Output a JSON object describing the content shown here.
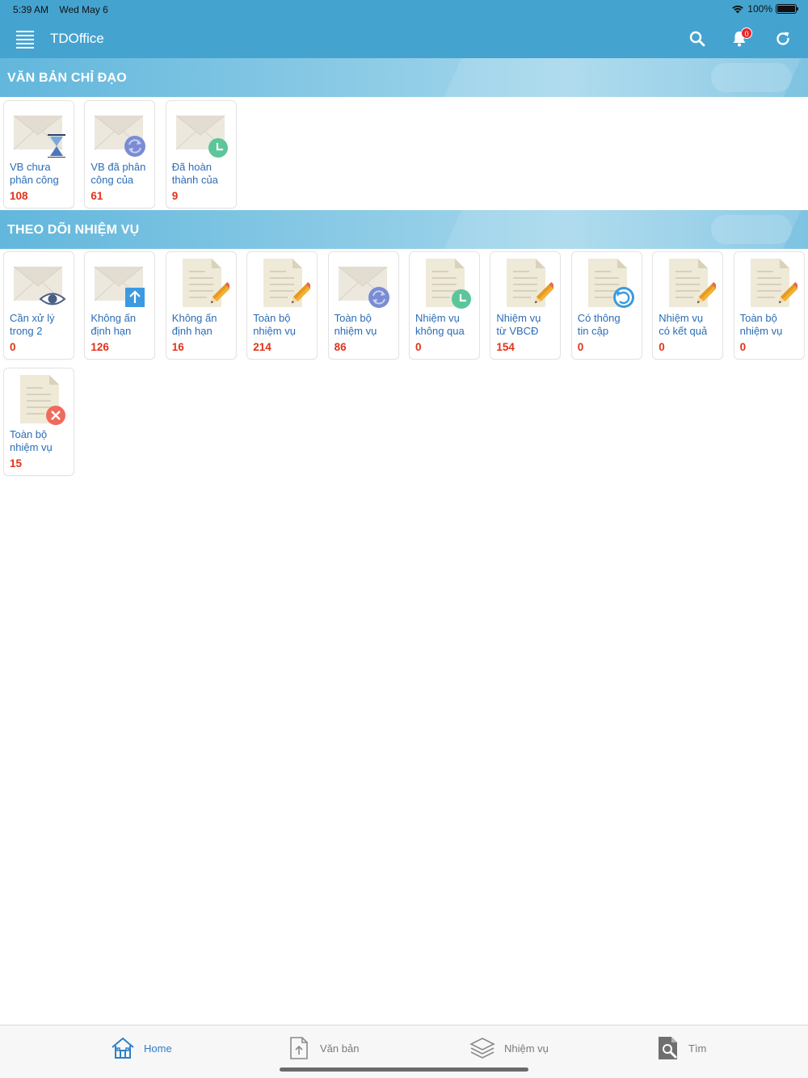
{
  "status": {
    "time": "5:39 AM",
    "date": "Wed May 6",
    "battery": "100%"
  },
  "header": {
    "title": "TDOffice",
    "notification_count": "0"
  },
  "sections": [
    {
      "title": "VĂN BẢN CHỈ ĐẠO",
      "tiles": [
        {
          "label": "VB chưa\nphân công",
          "count": "108",
          "icon": "envelope-hourglass-icon"
        },
        {
          "label": "VB đã phân\ncông của",
          "count": "61",
          "icon": "envelope-sync-icon"
        },
        {
          "label": "Đã hoàn\nthành của",
          "count": "9",
          "icon": "envelope-clock-icon"
        }
      ]
    },
    {
      "title": "THEO DÕI NHIỆM VỤ",
      "tiles": [
        {
          "label": "Cần xử lý\ntrong 2",
          "count": "0",
          "icon": "envelope-eye-icon"
        },
        {
          "label": "Không ấn\nđịnh hạn",
          "count": "126",
          "icon": "envelope-upload-icon"
        },
        {
          "label": "Không ấn\nđịnh hạn",
          "count": "16",
          "icon": "document-pencil-icon"
        },
        {
          "label": "Toàn bộ\nnhiệm vụ",
          "count": "214",
          "icon": "document-pencil-icon"
        },
        {
          "label": "Toàn bộ\nnhiệm vụ",
          "count": "86",
          "icon": "envelope-sync-icon"
        },
        {
          "label": "Nhiệm vụ\nkhông qua",
          "count": "0",
          "icon": "document-clock-icon"
        },
        {
          "label": "Nhiệm vụ\ntừ VBCĐ",
          "count": "154",
          "icon": "document-pencil-icon"
        },
        {
          "label": "Có thông\ntin cập",
          "count": "0",
          "icon": "document-refresh-icon"
        },
        {
          "label": "Nhiệm vụ\ncó kết quả",
          "count": "0",
          "icon": "document-pencil-icon"
        },
        {
          "label": "Toàn bộ\nnhiệm vụ",
          "count": "0",
          "icon": "document-pencil-icon"
        },
        {
          "label": "Toàn bộ\nnhiệm vụ",
          "count": "15",
          "icon": "document-cancel-icon"
        }
      ]
    }
  ],
  "tabs": [
    {
      "label": "Home",
      "icon": "home-icon",
      "active": true
    },
    {
      "label": "Văn bản",
      "icon": "document-upload-icon",
      "active": false
    },
    {
      "label": "Nhiệm vụ",
      "icon": "layers-icon",
      "active": false
    },
    {
      "label": "Tìm",
      "icon": "search-document-icon",
      "active": false
    }
  ],
  "colors": {
    "header": "#45a3cf",
    "label": "#2a6db5",
    "count": "#e2321a",
    "active_tab": "#2e7ec6"
  }
}
